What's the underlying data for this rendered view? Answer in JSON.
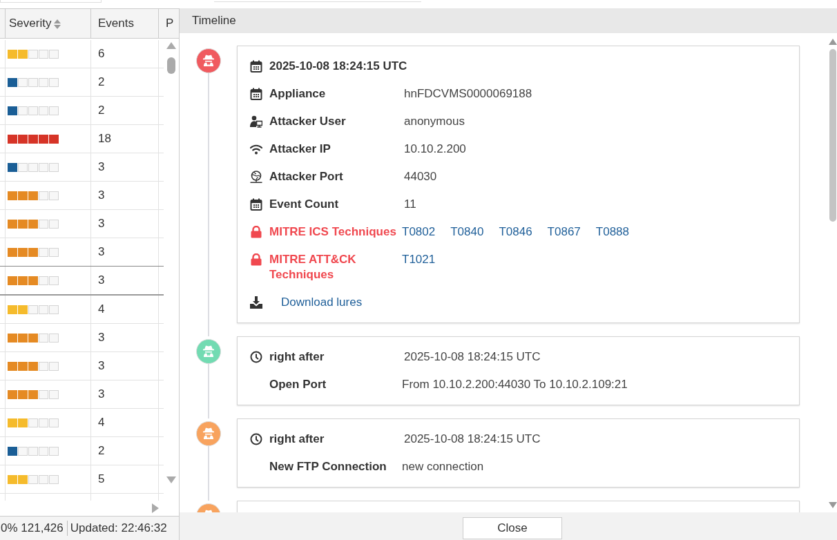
{
  "table": {
    "columns": [
      {
        "label": "Severity",
        "sortable": true
      },
      {
        "label": "Events",
        "sortable": false
      },
      {
        "label": "P",
        "sortable": false
      }
    ],
    "rows": [
      {
        "stars": 2,
        "color": "#f5bb2c",
        "events": "6",
        "selected": false
      },
      {
        "stars": 1,
        "color": "#1a5e96",
        "events": "2",
        "selected": false
      },
      {
        "stars": 1,
        "color": "#1a5e96",
        "events": "2",
        "selected": false
      },
      {
        "stars": 5,
        "color": "#d63427",
        "events": "18",
        "selected": false
      },
      {
        "stars": 1,
        "color": "#1a5e96",
        "events": "3",
        "selected": false
      },
      {
        "stars": 3,
        "color": "#e58a23",
        "events": "3",
        "selected": false
      },
      {
        "stars": 3,
        "color": "#e58a23",
        "events": "3",
        "selected": false
      },
      {
        "stars": 3,
        "color": "#e58a23",
        "events": "3",
        "selected": false
      },
      {
        "stars": 3,
        "color": "#e58a23",
        "events": "3",
        "selected": true
      },
      {
        "stars": 2,
        "color": "#f5bb2c",
        "events": "4",
        "selected": false
      },
      {
        "stars": 3,
        "color": "#e58a23",
        "events": "3",
        "selected": false
      },
      {
        "stars": 3,
        "color": "#e58a23",
        "events": "3",
        "selected": false
      },
      {
        "stars": 3,
        "color": "#e58a23",
        "events": "3",
        "selected": false
      },
      {
        "stars": 2,
        "color": "#f5bb2c",
        "events": "4",
        "selected": false
      },
      {
        "stars": 1,
        "color": "#1a5e96",
        "events": "2",
        "selected": false
      },
      {
        "stars": 2,
        "color": "#f5bb2c",
        "events": "5",
        "selected": false
      }
    ]
  },
  "status_bar": {
    "progress": "0% 121,426",
    "updated": "Updated: 22:46:32"
  },
  "dialog": {
    "title": "Timeline",
    "close": "Close",
    "events": [
      {
        "color": "#f05a5f",
        "rows": [
          {
            "kind": "heading",
            "label": "2025-10-08 18:24:15 UTC"
          },
          {
            "kind": "field",
            "label": "Appliance",
            "value": "hnFDCVMS0000069188"
          },
          {
            "kind": "field",
            "label": "Attacker User",
            "value": "anonymous"
          },
          {
            "kind": "field",
            "label": "Attacker IP",
            "value": "10.10.2.200"
          },
          {
            "kind": "field",
            "label": "Attacker Port",
            "value": "44030"
          },
          {
            "kind": "field",
            "label": "Event Count",
            "value": "11"
          },
          {
            "kind": "techniques",
            "label": "MITRE ICS Techniques",
            "links": [
              "T0802",
              "T0840",
              "T0846",
              "T0867",
              "T0888"
            ]
          },
          {
            "kind": "techniques",
            "label": "MITRE ATT&CK Techniques",
            "links": [
              "T1021"
            ]
          },
          {
            "kind": "download",
            "label": "Download lures"
          }
        ]
      },
      {
        "color": "#72dbb2",
        "rows": [
          {
            "kind": "time",
            "label": "right after",
            "value": "2025-10-08 18:24:15 UTC"
          },
          {
            "kind": "plain",
            "label": "Open Port",
            "value": "From 10.10.2.200:44030 To 10.10.2.109:21"
          }
        ]
      },
      {
        "color": "#f8a35e",
        "rows": [
          {
            "kind": "time",
            "label": "right after",
            "value": "2025-10-08 18:24:15 UTC"
          },
          {
            "kind": "plain",
            "label": "New FTP Connection",
            "value": "new connection"
          }
        ]
      },
      {
        "color": "#f8a35e"
      }
    ]
  }
}
